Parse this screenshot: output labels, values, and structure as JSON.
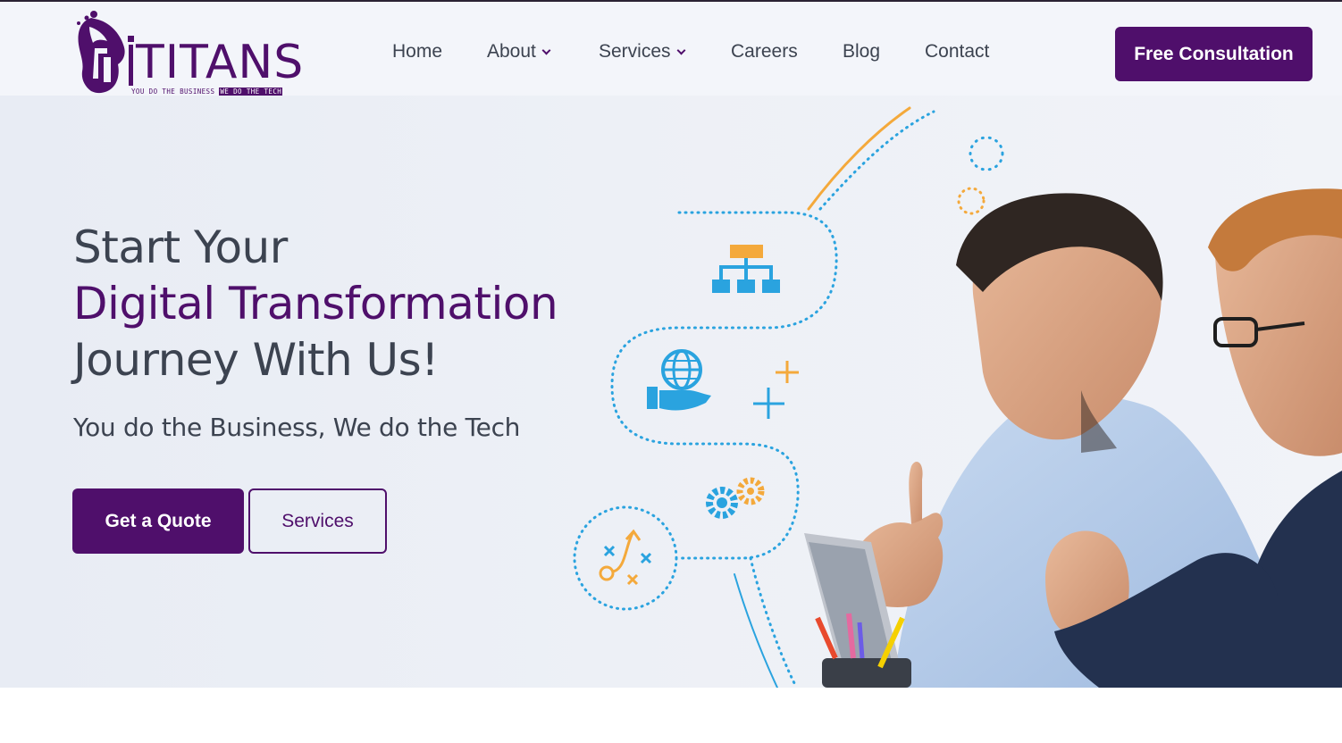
{
  "brand": {
    "name": "TITANS",
    "prefix": "i",
    "tagline_part1": "YOU DO THE BUSINESS",
    "tagline_part2": "WE DO THE TECH",
    "color": "#4f0f6b"
  },
  "nav": {
    "items": [
      {
        "label": "Home",
        "has_dropdown": false
      },
      {
        "label": "About",
        "has_dropdown": true
      },
      {
        "label": "Services",
        "has_dropdown": true
      },
      {
        "label": "Careers",
        "has_dropdown": false
      },
      {
        "label": "Blog",
        "has_dropdown": false
      },
      {
        "label": "Contact",
        "has_dropdown": false
      }
    ],
    "cta_label": "Free Consultation"
  },
  "hero": {
    "line1": "Start Your",
    "line2": "Digital Transformation",
    "line3": "Journey With Us!",
    "subtitle": "You do the Business, We do the Tech",
    "primary_button": "Get a Quote",
    "secondary_button": "Services"
  },
  "illustration": {
    "icons": [
      "hierarchy-icon",
      "globe-hand-icon",
      "gears-icon",
      "strategy-icon",
      "plus-icon"
    ],
    "colors": {
      "blue": "#2aa3df",
      "orange": "#f4a93b",
      "accent": "#4f0f6b"
    }
  }
}
